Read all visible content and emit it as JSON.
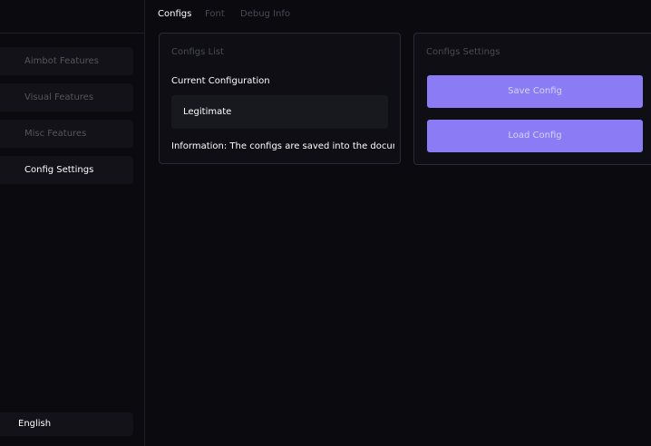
{
  "sidebar": {
    "items": [
      {
        "label": "Aimbot Features"
      },
      {
        "label": "Visual Features"
      },
      {
        "label": "Misc Features"
      },
      {
        "label": "Config Settings"
      }
    ],
    "language": "English"
  },
  "tabs": [
    {
      "label": "Configs"
    },
    {
      "label": "Font"
    },
    {
      "label": "Debug Info"
    }
  ],
  "configs_list": {
    "title": "Configs List",
    "current_label": "Current Configuration",
    "entries": [
      "Legitimate"
    ],
    "info": "Information: The configs are saved into the documents f"
  },
  "configs_settings": {
    "title": "Configs Settings",
    "save_label": "Save Config",
    "load_label": "Load Config"
  },
  "colors": {
    "accent": "#8b7cf6",
    "background": "#0a0a0f",
    "panel": "#0e0e14"
  }
}
